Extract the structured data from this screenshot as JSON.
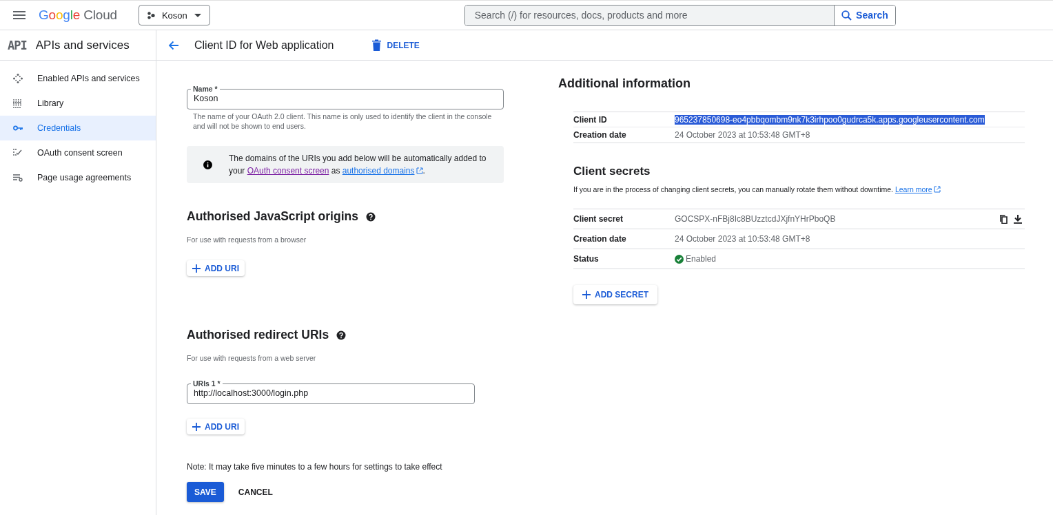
{
  "header": {
    "brand_first": "Google",
    "brand_second": "Cloud",
    "project": "Koson",
    "search_placeholder": "Search (/) for resources, docs, products and more",
    "search_button": "Search"
  },
  "sidebar": {
    "logo": "API",
    "title": "APIs and services",
    "items": [
      {
        "label": "Enabled APIs and services",
        "selected": false
      },
      {
        "label": "Library",
        "selected": false
      },
      {
        "label": "Credentials",
        "selected": true
      },
      {
        "label": "OAuth consent screen",
        "selected": false
      },
      {
        "label": "Page usage agreements",
        "selected": false
      }
    ]
  },
  "page_header": {
    "title": "Client ID for Web application",
    "delete": "DELETE"
  },
  "name_field": {
    "label": "Name *",
    "value": "Koson",
    "hint": "The name of your OAuth 2.0 client. This name is only used to identify the client in the console and will not be shown to end users."
  },
  "notice": {
    "before": "The domains of the URIs you add below will be automatically added to your ",
    "link_1": "OAuth consent screen",
    "middle": " as ",
    "link_2": "authorised domains",
    "after": "."
  },
  "js_origins": {
    "title": "Authorised JavaScript origins",
    "hint": "For use with requests from a browser",
    "add_button": "ADD URI"
  },
  "redirect_uris": {
    "title": "Authorised redirect URIs",
    "hint": "For use with requests from a web server",
    "uris": [
      {
        "label": "URIs 1 *",
        "value": "http://localhost:3000/login.php"
      }
    ],
    "add_button": "ADD URI"
  },
  "note": "Note: It may take five minutes to a few hours for settings to take effect",
  "actions": {
    "save": "SAVE",
    "cancel": "CANCEL"
  },
  "additional_info": {
    "title": "Additional information",
    "rows": [
      {
        "label": "Client ID",
        "value": "965237850698-eo4pbbqombm9nk7k3irhpoo0gudrca5k.apps.googleusercontent.com",
        "selected": true
      },
      {
        "label": "Creation date",
        "value": "24 October 2023 at 10:53:48 GMT+8",
        "selected": false
      }
    ]
  },
  "client_secrets": {
    "title": "Client secrets",
    "description": "If you are in the process of changing client secrets, you can manually rotate them without downtime. ",
    "learn_more": "Learn more",
    "rows": [
      {
        "kind": "secret",
        "label": "Client secret",
        "value": "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"
      },
      {
        "kind": "text",
        "label": "Creation date",
        "value": "24 October 2023 at 10:53:48 GMT+8"
      },
      {
        "kind": "status",
        "label": "Status",
        "value": "Enabled"
      }
    ],
    "add_button": "ADD SECRET"
  }
}
